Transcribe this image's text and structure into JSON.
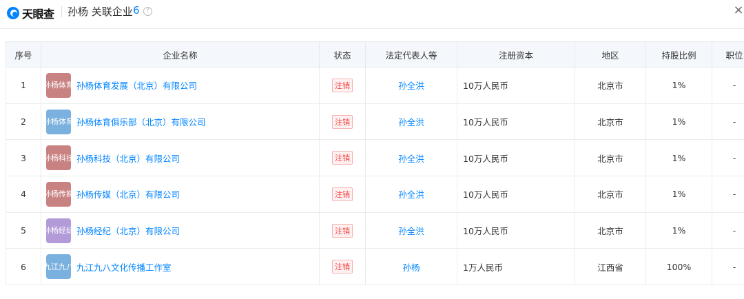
{
  "header": {
    "logo_text": "天眼查",
    "title": "孙杨 关联企业",
    "count": "6",
    "help_glyph": "?",
    "close_glyph": "×"
  },
  "table": {
    "columns": [
      "序号",
      "企业名称",
      "状态",
      "法定代表人等",
      "注册资本",
      "地区",
      "持股比例",
      "职位"
    ],
    "rows": [
      {
        "index": "1",
        "badge": "孙杨体育",
        "badge_color": "#c98282",
        "name": "孙杨体育发展（北京）有限公司",
        "status": "注销",
        "representative": "孙全洪",
        "capital": "10万人民币",
        "region": "北京市",
        "share": "1%",
        "position": "-"
      },
      {
        "index": "2",
        "badge": "孙杨体育",
        "badge_color": "#7ab1de",
        "name": "孙杨体育俱乐部（北京）有限公司",
        "status": "注销",
        "representative": "孙全洪",
        "capital": "10万人民币",
        "region": "北京市",
        "share": "1%",
        "position": "-"
      },
      {
        "index": "3",
        "badge": "孙杨科技",
        "badge_color": "#c98282",
        "name": "孙杨科技（北京）有限公司",
        "status": "注销",
        "representative": "孙全洪",
        "capital": "10万人民币",
        "region": "北京市",
        "share": "1%",
        "position": "-"
      },
      {
        "index": "4",
        "badge": "孙杨传媒",
        "badge_color": "#c98282",
        "name": "孙杨传媒（北京）有限公司",
        "status": "注销",
        "representative": "孙全洪",
        "capital": "10万人民币",
        "region": "北京市",
        "share": "1%",
        "position": "-"
      },
      {
        "index": "5",
        "badge": "孙杨经纪",
        "badge_color": "#b39ad9",
        "name": "孙杨经纪（北京）有限公司",
        "status": "注销",
        "representative": "孙全洪",
        "capital": "10万人民币",
        "region": "北京市",
        "share": "1%",
        "position": "-"
      },
      {
        "index": "6",
        "badge": "九江九八",
        "badge_color": "#7ab1de",
        "name": "九江九八文化传播工作室",
        "status": "注销",
        "representative": "孙杨",
        "capital": "1万人民币",
        "region": "江西省",
        "share": "100%",
        "position": "-"
      }
    ]
  }
}
